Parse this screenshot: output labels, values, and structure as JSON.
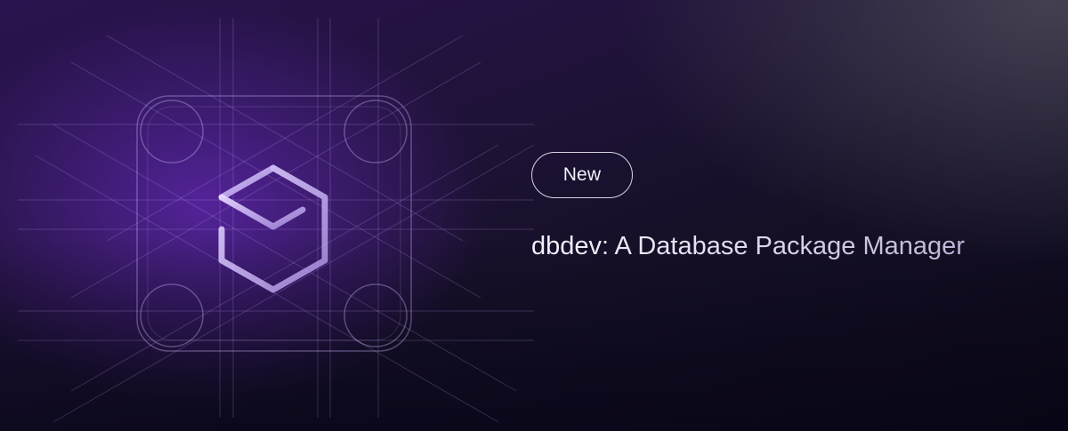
{
  "badge": {
    "label": "New"
  },
  "headline": {
    "text": "dbdev: A Database Package Manager"
  },
  "icons": {
    "logo": "hexagon-box-icon",
    "grid": "construction-grid"
  },
  "colors": {
    "accent_purple": "#5c26aa",
    "text_light": "#f1eef8",
    "background_dark": "#0c0918"
  }
}
